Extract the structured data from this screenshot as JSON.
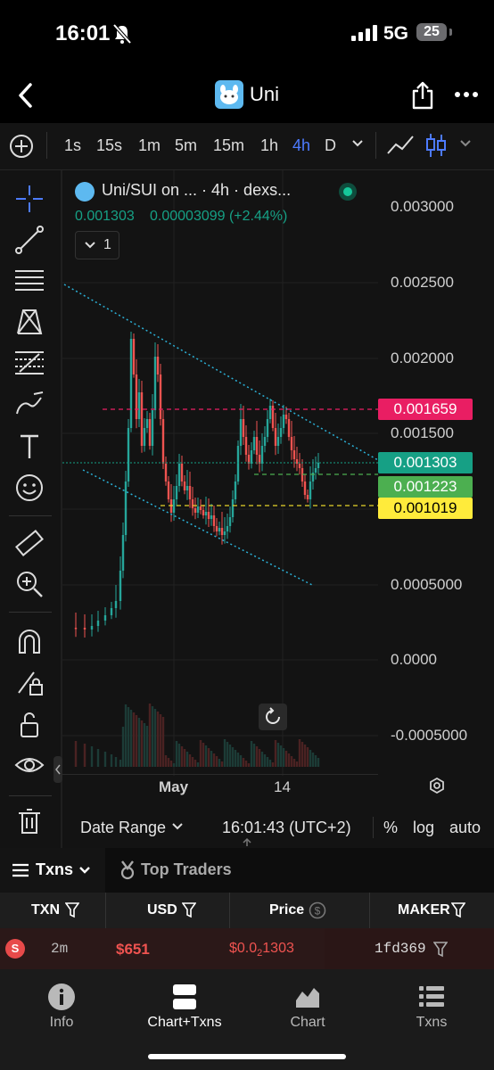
{
  "status": {
    "time": "16:01",
    "network": "5G",
    "battery": "25"
  },
  "header": {
    "title": "Uni"
  },
  "toolbar": {
    "timeframes": [
      "1s",
      "15s",
      "1m",
      "5m",
      "15m",
      "1h",
      "4h",
      "D"
    ],
    "active_timeframe": "4h"
  },
  "chart": {
    "legend_title": "Uni/SUI on ... · 4h · dexs...",
    "ohlc_price": "0.001303",
    "change": "0.00003099 (+2.44%)",
    "indicator_count": "1",
    "price_axis": [
      "0.003000",
      "0.002500",
      "0.002000",
      "0.001500",
      "0.0005000",
      "0.0000",
      "-0.0005000"
    ],
    "time_axis": [
      "May",
      "14"
    ],
    "tags": {
      "red": "0.001659",
      "teal": "0.001303",
      "green": "0.001223",
      "yellow": "0.001019"
    },
    "colors": {
      "red": "#e91e63",
      "teal": "#16a085",
      "green": "#4caf50",
      "yellow": "#ffeb3b",
      "up": "#26a69a",
      "down": "#ef5350"
    }
  },
  "chart_footer": {
    "date_range": "Date Range",
    "clock": "16:01:43 (UTC+2)",
    "percent": "%",
    "log": "log",
    "auto": "auto"
  },
  "tabs": {
    "txns": "Txns",
    "top_traders": "Top Traders"
  },
  "table": {
    "headers": [
      "TXN",
      "USD",
      "Price",
      "MAKER"
    ],
    "rows": [
      {
        "type": "S",
        "age": "2m",
        "usd": "$651",
        "price_prefix": "$0.0",
        "price_sub": "2",
        "price_rest": "1303",
        "maker": "1fd369"
      }
    ]
  },
  "nav": [
    {
      "label": "Info",
      "icon": "info-icon"
    },
    {
      "label": "Chart+Txns",
      "icon": "chart-txns-icon"
    },
    {
      "label": "Chart",
      "icon": "chart-icon"
    },
    {
      "label": "Txns",
      "icon": "list-icon"
    }
  ],
  "nav_active": "Chart+Txns"
}
